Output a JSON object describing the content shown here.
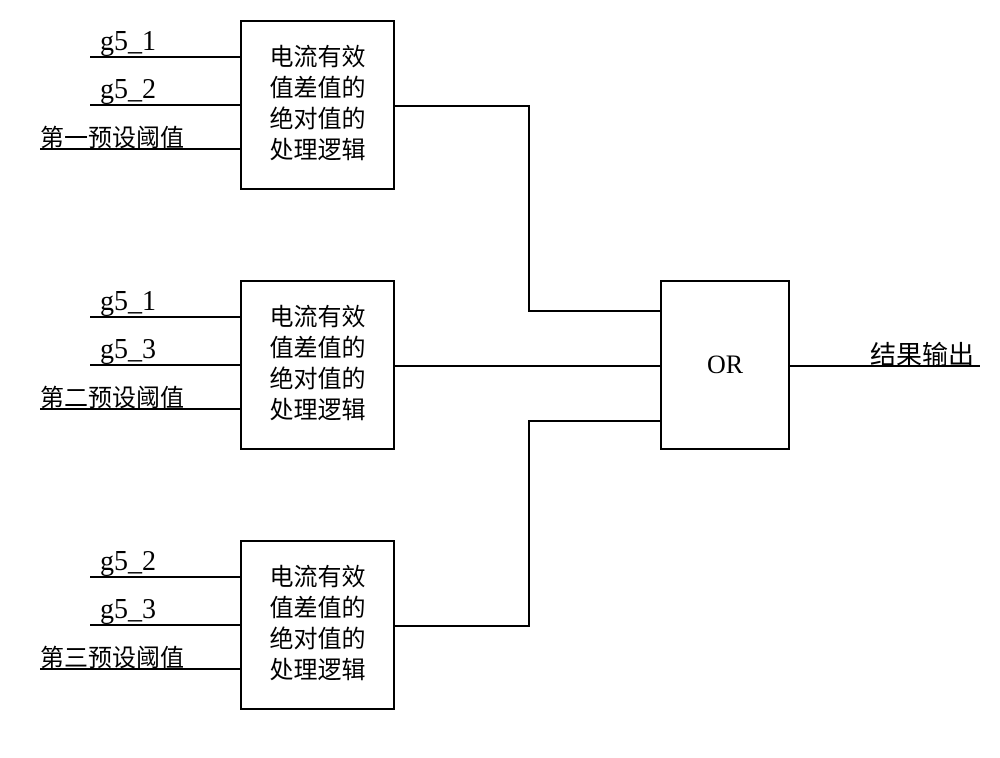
{
  "blocks": {
    "logic1": {
      "label": "电流有效\n值差值的\n绝对值的\n处理逻辑",
      "inputs": {
        "i1": "g5_1",
        "i2": "g5_2",
        "i3": "第一预设阈值"
      }
    },
    "logic2": {
      "label": "电流有效\n值差值的\n绝对值的\n处理逻辑",
      "inputs": {
        "i1": "g5_1",
        "i2": "g5_3",
        "i3": "第二预设阈值"
      }
    },
    "logic3": {
      "label": "电流有效\n值差值的\n绝对值的\n处理逻辑",
      "inputs": {
        "i1": "g5_2",
        "i2": "g5_3",
        "i3": "第三预设阈值"
      }
    },
    "or": {
      "label": "OR"
    }
  },
  "output": {
    "label": "结果输出"
  }
}
